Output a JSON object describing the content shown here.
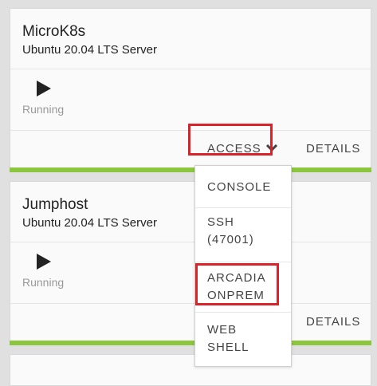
{
  "instances": [
    {
      "name": "MicroK8s",
      "os": "Ubuntu 20.04 LTS Server",
      "status": "Running",
      "access_label": "ACCESS",
      "details_label": "DETAILS"
    },
    {
      "name": "Jumphost",
      "os": "Ubuntu 20.04 LTS Server",
      "status": "Running",
      "details_label": "DETAILS"
    }
  ],
  "access_menu": {
    "items": [
      {
        "line1": "CONSOLE",
        "line2": ""
      },
      {
        "line1": "SSH",
        "line2": "(47001)"
      },
      {
        "line1": "ARCADIA",
        "line2": "ONPREM"
      },
      {
        "line1": "WEB",
        "line2": "SHELL"
      }
    ]
  },
  "colors": {
    "highlight": "#d9232a",
    "status_bar": "#8cc63f"
  }
}
